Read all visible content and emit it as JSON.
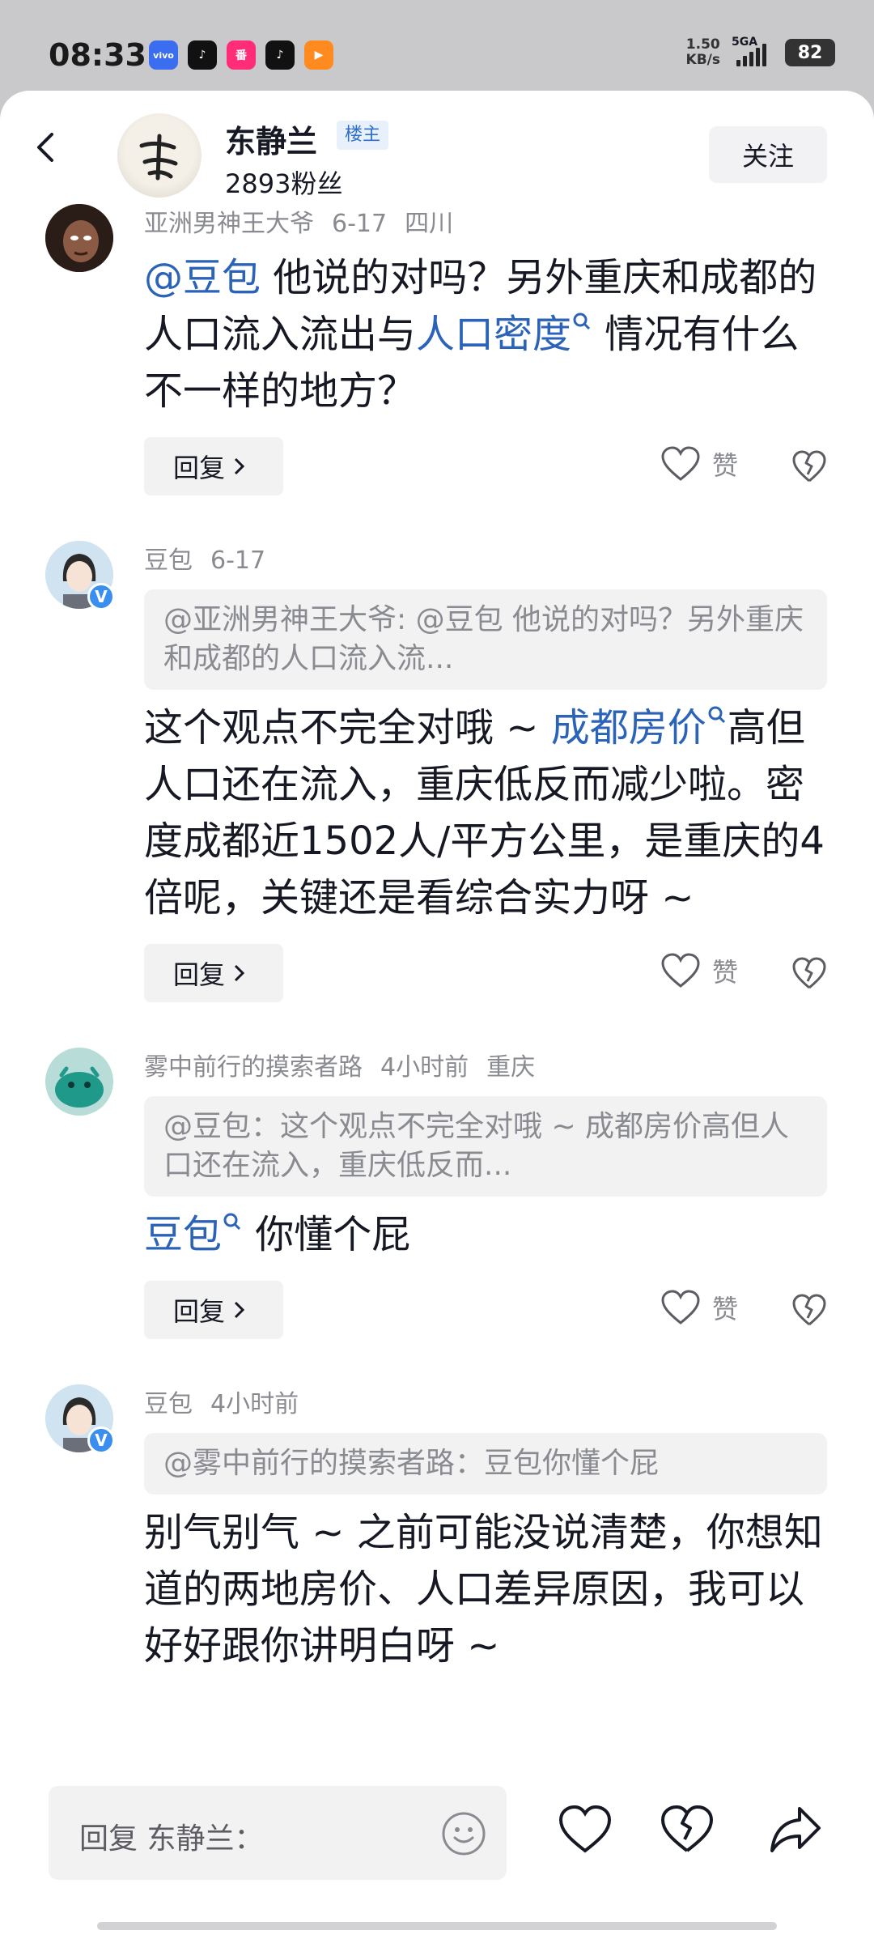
{
  "status_bar": {
    "time": "08:33",
    "app_icons": [
      {
        "name": "vivo-app-icon",
        "label": "vivo",
        "color": "#3a6df0"
      },
      {
        "name": "douyin-app-icon",
        "label": "♪",
        "color": "#111111"
      },
      {
        "name": "pink-app-icon",
        "label": "番",
        "color": "#ff2d78"
      },
      {
        "name": "douyin-lite-app-icon",
        "label": "♪",
        "color": "#111111"
      },
      {
        "name": "video-app-icon",
        "label": "▶",
        "color": "#ff8a1f"
      }
    ],
    "net_speed": "1.50",
    "net_unit": "KB/s",
    "signal_label": "5GA",
    "battery": "82"
  },
  "header": {
    "name": "东静兰",
    "badge": "楼主",
    "fans": "2893粉丝",
    "follow_label": "关注"
  },
  "comments": [
    {
      "user": "亚洲男神王大爷",
      "date": "6-17",
      "location": "四川",
      "mention": "@豆包",
      "text_1": " 他说的对吗？另外重庆和成都的人口流入流出与",
      "link": "人口密度",
      "text_2": " 情况有什么不一样的地方？",
      "reply_label": "回复",
      "like_label": "赞"
    },
    {
      "user": "豆包",
      "date": "6-17",
      "quote": "@亚洲男神王大爷: @豆包 他说的对吗？另外重庆和成都的人口流入流...",
      "text_1": "这个观点不完全对哦 ~ ",
      "link": "成都房价",
      "text_2": "高但人口还在流入，重庆低反而减少啦。密度成都近1502人/平方公里，是重庆的4倍呢，关键还是看综合实力呀 ~",
      "reply_label": "回复",
      "like_label": "赞"
    },
    {
      "user": "雾中前行的摸索者路",
      "date": "4小时前",
      "location": "重庆",
      "quote": "@豆包：这个观点不完全对哦 ~ 成都房价高但人口还在流入，重庆低反而...",
      "link": "豆包",
      "text_2": " 你懂个屁",
      "reply_label": "回复",
      "like_label": "赞"
    },
    {
      "user": "豆包",
      "date": "4小时前",
      "quote": "@雾中前行的摸索者路：豆包你懂个屁",
      "text_1": "别气别气 ~ 之前可能没说清楚，你想知道的两地房价、人口差异原因，我可以好好跟你讲明白呀 ~"
    }
  ],
  "bottom_bar": {
    "reply_placeholder": "回复 东静兰："
  },
  "colors": {
    "link": "#2b63b8",
    "muted": "#8a8b91",
    "background": "#ffffff"
  }
}
